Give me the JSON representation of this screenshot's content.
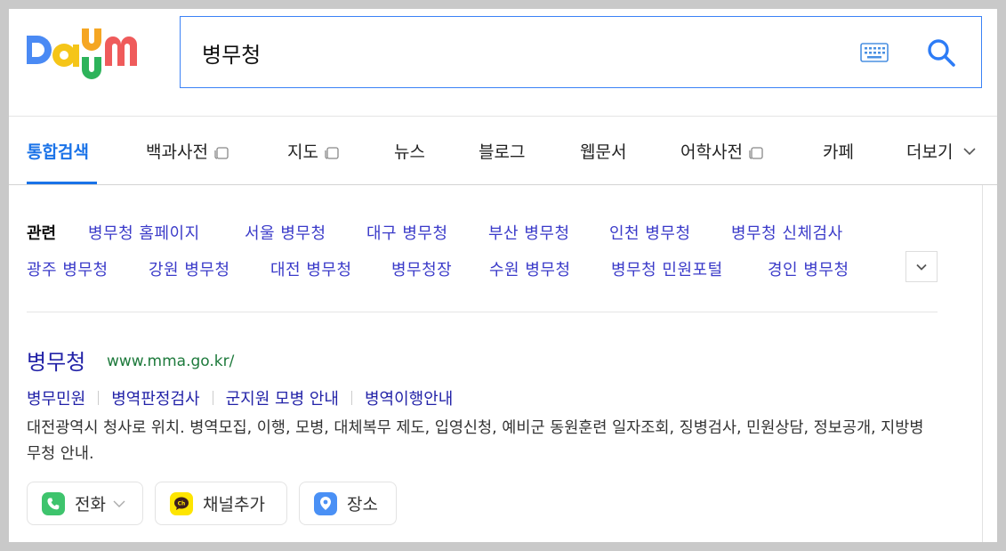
{
  "brand": {
    "name": "Daum"
  },
  "search": {
    "query": "병무청"
  },
  "tabs": [
    {
      "label": "통합검색",
      "active": true
    },
    {
      "label": "백과사전",
      "external": true
    },
    {
      "label": "지도",
      "external": true
    },
    {
      "label": "뉴스"
    },
    {
      "label": "블로그"
    },
    {
      "label": "웹문서"
    },
    {
      "label": "어학사전",
      "external": true
    },
    {
      "label": "카페"
    },
    {
      "label": "더보기"
    }
  ],
  "related": {
    "label": "관련",
    "row1": [
      "병무청 홈페이지",
      "서울 병무청",
      "대구 병무청",
      "부산 병무청",
      "인천 병무청",
      "병무청 신체검사"
    ],
    "row2": [
      "광주 병무청",
      "강원 병무청",
      "대전 병무청",
      "병무청장",
      "수원 병무청",
      "병무청 민원포털",
      "경인 병무청"
    ]
  },
  "result": {
    "title": "병무청",
    "url": "www.mma.go.kr/",
    "sublinks": [
      "병무민원",
      "병역판정검사",
      "군지원 모병 안내",
      "병역이행안내"
    ],
    "description": "대전광역시 청사로 위치. 병역모집, 이행, 모병, 대체복무 제도, 입영신청, 예비군 동원훈련 일자조회, 징병검사, 민원상담, 정보공개, 지방병무청 안내.",
    "actions": [
      {
        "label": "전화",
        "icon": "phone-icon",
        "color": "#3ec46d"
      },
      {
        "label": "채널추가",
        "icon": "kakao-channel-icon",
        "color": "#fee500"
      },
      {
        "label": "장소",
        "icon": "location-icon",
        "color": "#4a90f5"
      }
    ]
  },
  "colors": {
    "accent": "#1a73e8",
    "link": "#3b3bc9",
    "url": "#1e7a3c"
  }
}
